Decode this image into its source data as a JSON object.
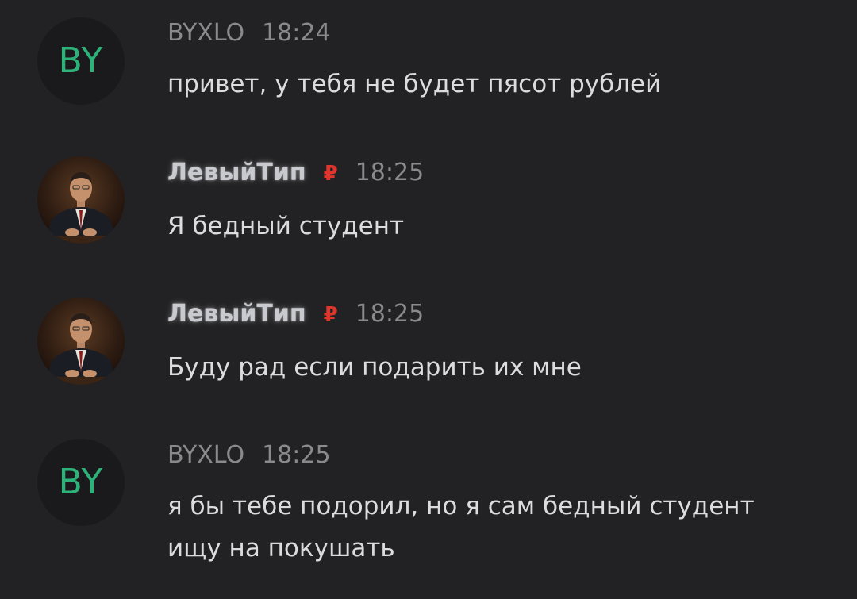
{
  "messages": [
    {
      "avatar_text": "BY",
      "author": "BYXLO",
      "time": "18:24",
      "lines": [
        "привет, у тебя не будет пясот рублей"
      ]
    },
    {
      "author": "ЛевыйТип",
      "badge": "₽",
      "time": "18:25",
      "lines": [
        "Я бедный студент"
      ]
    },
    {
      "author": "ЛевыйТип",
      "badge": "₽",
      "time": "18:25",
      "lines": [
        "Буду рад если подарить их мне"
      ]
    },
    {
      "avatar_text": "BY",
      "author": "BYXLO",
      "time": "18:25",
      "lines": [
        "я бы тебе подорил, но я сам бедный студент",
        "ищу на покушать"
      ]
    }
  ],
  "colors": {
    "background": "#222224",
    "avatar_initials": "#2db37a",
    "badge": "#e0352c"
  }
}
